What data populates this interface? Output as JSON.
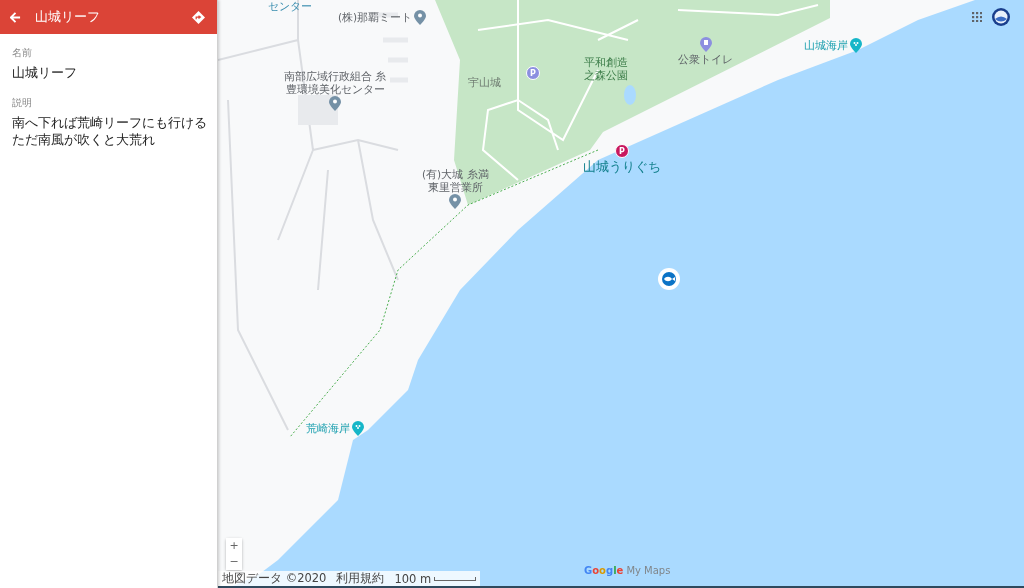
{
  "sidebar": {
    "title": "山城リーフ",
    "fields": [
      {
        "label": "名前",
        "value": "山城リーフ"
      },
      {
        "label": "説明",
        "lines": [
          "南へ下れば荒崎リーフにも行ける",
          "ただ南風が吹くと大荒れ"
        ]
      }
    ]
  },
  "map": {
    "places": [
      {
        "kind": "area",
        "name": "センター"
      },
      {
        "kind": "place",
        "name": "(株)那覇ミート"
      },
      {
        "kind": "place",
        "lines": [
          "南部広域行政組合 糸",
          "豊環境美化センター"
        ]
      },
      {
        "kind": "label",
        "name": "宇山城"
      },
      {
        "kind": "parking",
        "glyph": "P"
      },
      {
        "kind": "park",
        "lines": [
          "平和創造",
          "之森公園"
        ]
      },
      {
        "kind": "toilet",
        "name": "公衆トイレ"
      },
      {
        "kind": "beach",
        "name": "山城海岸"
      },
      {
        "kind": "parking-red",
        "glyph": "P",
        "name": "山城うりぐち"
      },
      {
        "kind": "place",
        "lines": [
          "(有)大城 糸満",
          "東里営業所"
        ]
      },
      {
        "kind": "beach",
        "name": "荒崎海岸"
      }
    ],
    "zoom": {
      "in": "+",
      "out": "−"
    },
    "footer": {
      "map_data": "地図データ ©2020",
      "terms": "利用規約",
      "scale": "100 m"
    },
    "logo": {
      "brand": "Google",
      "product": "My Maps"
    }
  }
}
